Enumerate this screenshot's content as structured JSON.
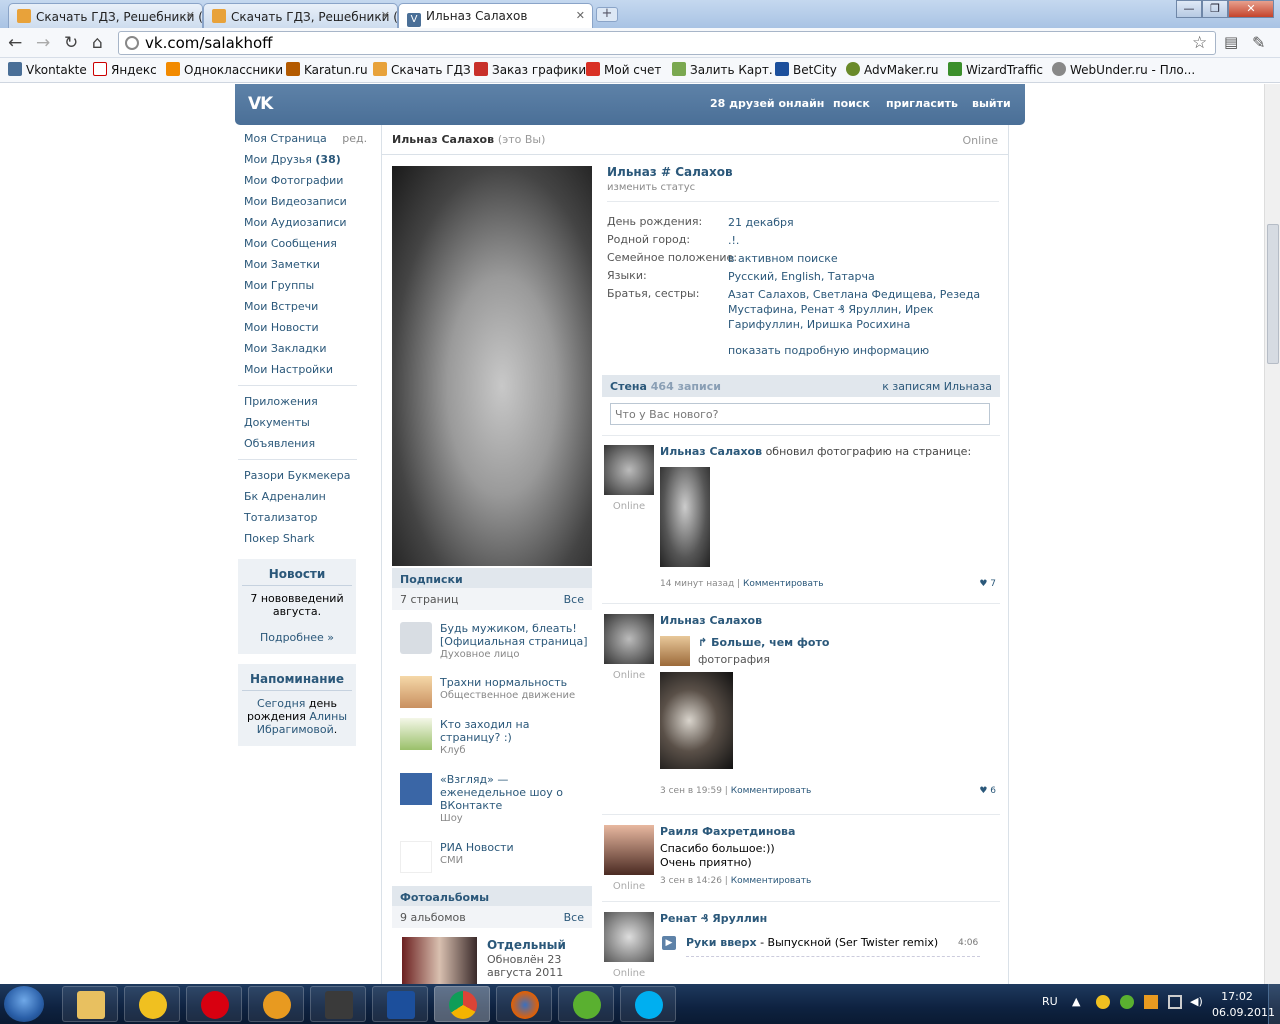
{
  "browser": {
    "tabs": [
      {
        "label": "Скачать ГДЗ, Решебники (",
        "active": false
      },
      {
        "label": "Скачать ГДЗ, Решебники (",
        "active": false
      },
      {
        "label": "Ильназ Салахов",
        "active": true
      }
    ],
    "url": "vk.com/salakhoff",
    "bookmarks": [
      "Vkontakte",
      "Яндекс",
      "Одноклассники",
      "Karatun.ru",
      "Скачать ГДЗ",
      "Заказ графики",
      "Мой счет",
      "Залить Карт.",
      "BetCity",
      "AdvMaker.ru",
      "WizardTraffic",
      "WebUnder.ru - Пло..."
    ]
  },
  "header": {
    "logo": "VK",
    "friends_online": "28 друзей онлайн",
    "search": "поиск",
    "invite": "пригласить",
    "logout": "выйти"
  },
  "sidebar": {
    "items": [
      {
        "label": "Моя Страница",
        "extra": "ред."
      },
      {
        "label": "Мои Друзья",
        "extra": "(38)"
      },
      {
        "label": "Мои Фотографии"
      },
      {
        "label": "Мои Видеозаписи"
      },
      {
        "label": "Мои Аудиозаписи"
      },
      {
        "label": "Мои Сообщения"
      },
      {
        "label": "Мои Заметки"
      },
      {
        "label": "Мои Группы"
      },
      {
        "label": "Мои Встречи"
      },
      {
        "label": "Мои Новости"
      },
      {
        "label": "Мои Закладки"
      },
      {
        "label": "Мои Настройки"
      }
    ],
    "apps": [
      "Приложения",
      "Документы",
      "Объявления"
    ],
    "links": [
      "Разори Букмекера",
      "Бк Адреналин",
      "Тотализатор",
      "Покер Shark"
    ],
    "news_box": {
      "title": "Новости",
      "text": "7 нововведений августа.",
      "more": "Подробнее »"
    },
    "reminder_box": {
      "title": "Напоминание",
      "today": "Сегодня",
      "text": "день рождения",
      "name": "Алины Ибрагимовой",
      "dot": "."
    }
  },
  "profile": {
    "title_name": "Ильназ Салахов",
    "title_you": "(это Вы)",
    "title_online": "Online",
    "name": "Ильназ # Салахов",
    "status_hint": "изменить статус",
    "info": [
      {
        "k": "День рождения:",
        "v": "21 декабря"
      },
      {
        "k": "Родной город:",
        "v": ".!."
      },
      {
        "k": "Семейное положение:",
        "v": "в активном поиске"
      },
      {
        "k": "Языки:",
        "v": "Русский, English, Татарча"
      },
      {
        "k": "Братья, сестры:",
        "v": "Азат Салахов, Светлана Федищева, Резеда Мустафина, Ренат ₰ Яруллин, Ирек Гарифуллин, Иришка Росихина"
      }
    ],
    "more_info": "показать подробную информацию"
  },
  "subscriptions": {
    "title": "Подписки",
    "count": "7 страниц",
    "all": "Все",
    "items": [
      {
        "name": "Будь мужиком, блеать! [Официальная страница]",
        "desc": "Духовное лицо"
      },
      {
        "name": "Трахни нормальность",
        "desc": "Общественное движение"
      },
      {
        "name": "Кто заходил на страницу? :)",
        "desc": "Клуб"
      },
      {
        "name": "«Взгляд» — еженедельное шоу о ВКонтакте",
        "desc": "Шоу"
      },
      {
        "name": "РИА Новости",
        "desc": "СМИ"
      }
    ]
  },
  "albums": {
    "title": "Фотоальбомы",
    "count": "9 альбомов",
    "all": "Все",
    "first_name": "Отдельный",
    "first_updated": "Обновлён 23 августа 2011"
  },
  "wall": {
    "title": "Стена",
    "count": "464 записи",
    "to_posts": "к записям Ильназа",
    "input_placeholder": "Что у Вас нового?",
    "posts": [
      {
        "author": "Ильназ Салахов",
        "action": "обновил фотографию на странице:",
        "online": "Online",
        "time": "14 минут назад",
        "comment": "Комментировать",
        "likes": "7"
      },
      {
        "author": "Ильназ Салахов",
        "repost_title": "Больше, чем фото",
        "repost_sub": "фотография",
        "online": "Online",
        "time": "3 сен в 19:59",
        "comment": "Комментировать",
        "likes": "6"
      },
      {
        "author": "Раиля Фахретдинова",
        "text1": "Спасибо большое:))",
        "text2": "Очень приятно)",
        "online": "Online",
        "time": "3 сен в 14:26",
        "comment": "Комментировать"
      },
      {
        "author": "Ренат ₰ Яруллин",
        "audio_artist": "Руки вверх",
        "audio_title": "- Выпускной (Ser Twister remix)",
        "audio_time": "4:06",
        "online": "Online"
      }
    ]
  },
  "taskbar": {
    "lang": "RU",
    "time": "17:02",
    "date": "06.09.2011"
  },
  "colors": {
    "vk_header": "#5e82a8",
    "link": "#2b587a",
    "panel": "#e1e7ed"
  }
}
